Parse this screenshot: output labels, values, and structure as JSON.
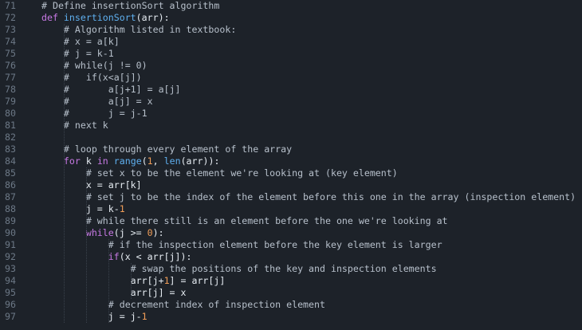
{
  "editor": {
    "line_numbers": [
      "71",
      "72",
      "73",
      "74",
      "75",
      "76",
      "77",
      "78",
      "79",
      "80",
      "81",
      "82",
      "83",
      "84",
      "85",
      "86",
      "87",
      "88",
      "89",
      "90",
      "91",
      "92",
      "93",
      "94",
      "95",
      "96",
      "97"
    ],
    "lines": [
      [
        {
          "t": "# Define insertionSort algorithm",
          "c": "cm"
        }
      ],
      [
        {
          "t": "def ",
          "c": "kw"
        },
        {
          "t": "insertionSort",
          "c": "fn"
        },
        {
          "t": "(arr):",
          "c": "op"
        }
      ],
      [
        {
          "t": "    # Algorithm listed in textbook:",
          "c": "cm"
        }
      ],
      [
        {
          "t": "    # x = a[k]",
          "c": "cm"
        }
      ],
      [
        {
          "t": "    # j = k-1",
          "c": "cm"
        }
      ],
      [
        {
          "t": "    # while(j != 0)",
          "c": "cm"
        }
      ],
      [
        {
          "t": "    #   if(x<a[j])",
          "c": "cm"
        }
      ],
      [
        {
          "t": "    #       a[j+1] = a[j]",
          "c": "cm"
        }
      ],
      [
        {
          "t": "    #       a[j] = x",
          "c": "cm"
        }
      ],
      [
        {
          "t": "    #       j = j-1",
          "c": "cm"
        }
      ],
      [
        {
          "t": "    # next k",
          "c": "cm"
        }
      ],
      [],
      [
        {
          "t": "    # loop through every element of the array",
          "c": "cm"
        }
      ],
      [
        {
          "t": "    ",
          "c": "op"
        },
        {
          "t": "for",
          "c": "kw"
        },
        {
          "t": " k ",
          "c": "op"
        },
        {
          "t": "in",
          "c": "kw"
        },
        {
          "t": " ",
          "c": "op"
        },
        {
          "t": "range",
          "c": "bi"
        },
        {
          "t": "(",
          "c": "op"
        },
        {
          "t": "1",
          "c": "num"
        },
        {
          "t": ", ",
          "c": "op"
        },
        {
          "t": "len",
          "c": "bi"
        },
        {
          "t": "(arr)):",
          "c": "op"
        }
      ],
      [
        {
          "t": "        # set x to be the element we're looking at (key element)",
          "c": "cm"
        }
      ],
      [
        {
          "t": "        x = arr[k]",
          "c": "op"
        }
      ],
      [
        {
          "t": "        # set j to be the index of the element before this one in the array (inspection element)",
          "c": "cm"
        }
      ],
      [
        {
          "t": "        j = k-",
          "c": "op"
        },
        {
          "t": "1",
          "c": "num"
        }
      ],
      [
        {
          "t": "        # while there still is an element before the one we're looking at",
          "c": "cm"
        }
      ],
      [
        {
          "t": "        ",
          "c": "op"
        },
        {
          "t": "while",
          "c": "kw"
        },
        {
          "t": "(j >= ",
          "c": "op"
        },
        {
          "t": "0",
          "c": "num"
        },
        {
          "t": "):",
          "c": "op"
        }
      ],
      [
        {
          "t": "            # if the inspection element before the key element is larger",
          "c": "cm"
        }
      ],
      [
        {
          "t": "            ",
          "c": "op"
        },
        {
          "t": "if",
          "c": "kw"
        },
        {
          "t": "(x < arr[j]):",
          "c": "op"
        }
      ],
      [
        {
          "t": "                # swap the positions of the key and inspection elements",
          "c": "cm"
        }
      ],
      [
        {
          "t": "                arr[j+",
          "c": "op"
        },
        {
          "t": "1",
          "c": "num"
        },
        {
          "t": "] = arr[j]",
          "c": "op"
        }
      ],
      [
        {
          "t": "                arr[j] = x",
          "c": "op"
        }
      ],
      [
        {
          "t": "            # decrement index of inspection element",
          "c": "cm"
        }
      ],
      [
        {
          "t": "            j = j-",
          "c": "op"
        },
        {
          "t": "1",
          "c": "num"
        }
      ]
    ]
  },
  "colors": {
    "background": "#1d2229",
    "comment": "#b7c0cb",
    "keyword": "#c779e4",
    "function": "#5fb0f0",
    "number": "#f09d58",
    "line_number": "#6c7886"
  },
  "icons": {
    "indent_guides": "dotted-indent-guide"
  }
}
